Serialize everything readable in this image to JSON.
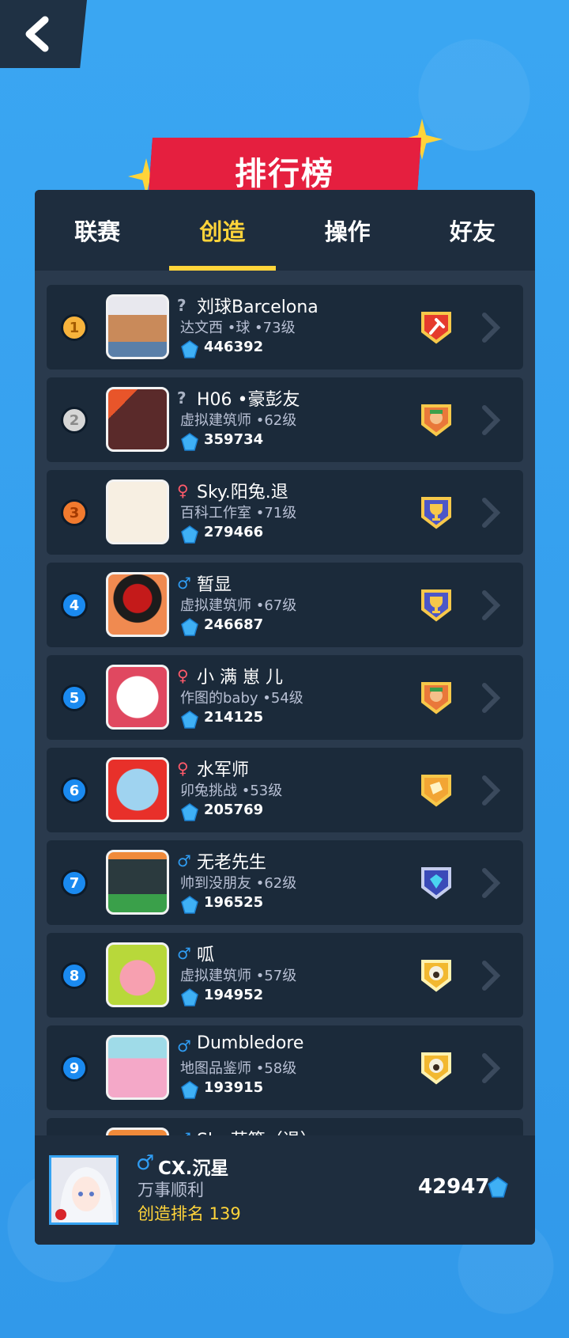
{
  "title": "排行榜",
  "tabs": [
    {
      "label": "联赛",
      "active": false
    },
    {
      "label": "创造",
      "active": true
    },
    {
      "label": "操作",
      "active": false
    },
    {
      "label": "好友",
      "active": false
    }
  ],
  "rows": [
    {
      "rank": "1",
      "gender": "?",
      "name": "刘球Barcelona",
      "sub": "达文西 •球 •73级",
      "score": "446392",
      "badge": "hammer-badge-icon"
    },
    {
      "rank": "2",
      "gender": "?",
      "name": "H06 •豪彭友",
      "sub": "虚拟建筑师 •62级",
      "score": "359734",
      "badge": "builder-badge-icon"
    },
    {
      "rank": "3",
      "gender": "♀",
      "name": "Sky.阳兔.退",
      "sub": "百科工作室 •71级",
      "score": "279466",
      "badge": "trophy-badge-icon"
    },
    {
      "rank": "4",
      "gender": "♂",
      "name": "暂显",
      "sub": "虚拟建筑师 •67级",
      "score": "246687",
      "badge": "trophy-badge-icon"
    },
    {
      "rank": "5",
      "gender": "♀",
      "name": "小 满 崽 儿",
      "sub": "作图的baby •54级",
      "score": "214125",
      "badge": "builder-badge-icon"
    },
    {
      "rank": "6",
      "gender": "♀",
      "name": "水军师",
      "sub": "卯兔挑战 •53级",
      "score": "205769",
      "badge": "gold-shape-badge-icon"
    },
    {
      "rank": "7",
      "gender": "♂",
      "name": "无老先生",
      "sub": "帅到没朋友 •62级",
      "score": "196525",
      "badge": "gem-badge-icon"
    },
    {
      "rank": "8",
      "gender": "♂",
      "name": "呱",
      "sub": "虚拟建筑师 •57级",
      "score": "194952",
      "badge": "sheep-badge-icon"
    },
    {
      "rank": "9",
      "gender": "♂",
      "name": "Dumbledore",
      "sub": "地图品鉴师 •58级",
      "score": "193915",
      "badge": "sheep-badge-icon"
    },
    {
      "rank": "",
      "gender": "♂",
      "name": "Sky.苏筱（退）",
      "sub": "",
      "score": "",
      "badge": ""
    }
  ],
  "me": {
    "gender": "♂",
    "name": "CX.沉星",
    "sub": "万事顺利",
    "rank_label": "创造排名 139",
    "score": "42947"
  },
  "colors": {
    "accent": "#ffd43a",
    "banner": "#e51f3f",
    "panel": "#2a3a4d",
    "row": "#1b2a3a",
    "male": "#2f9cf2",
    "female": "#ff5a6a"
  }
}
